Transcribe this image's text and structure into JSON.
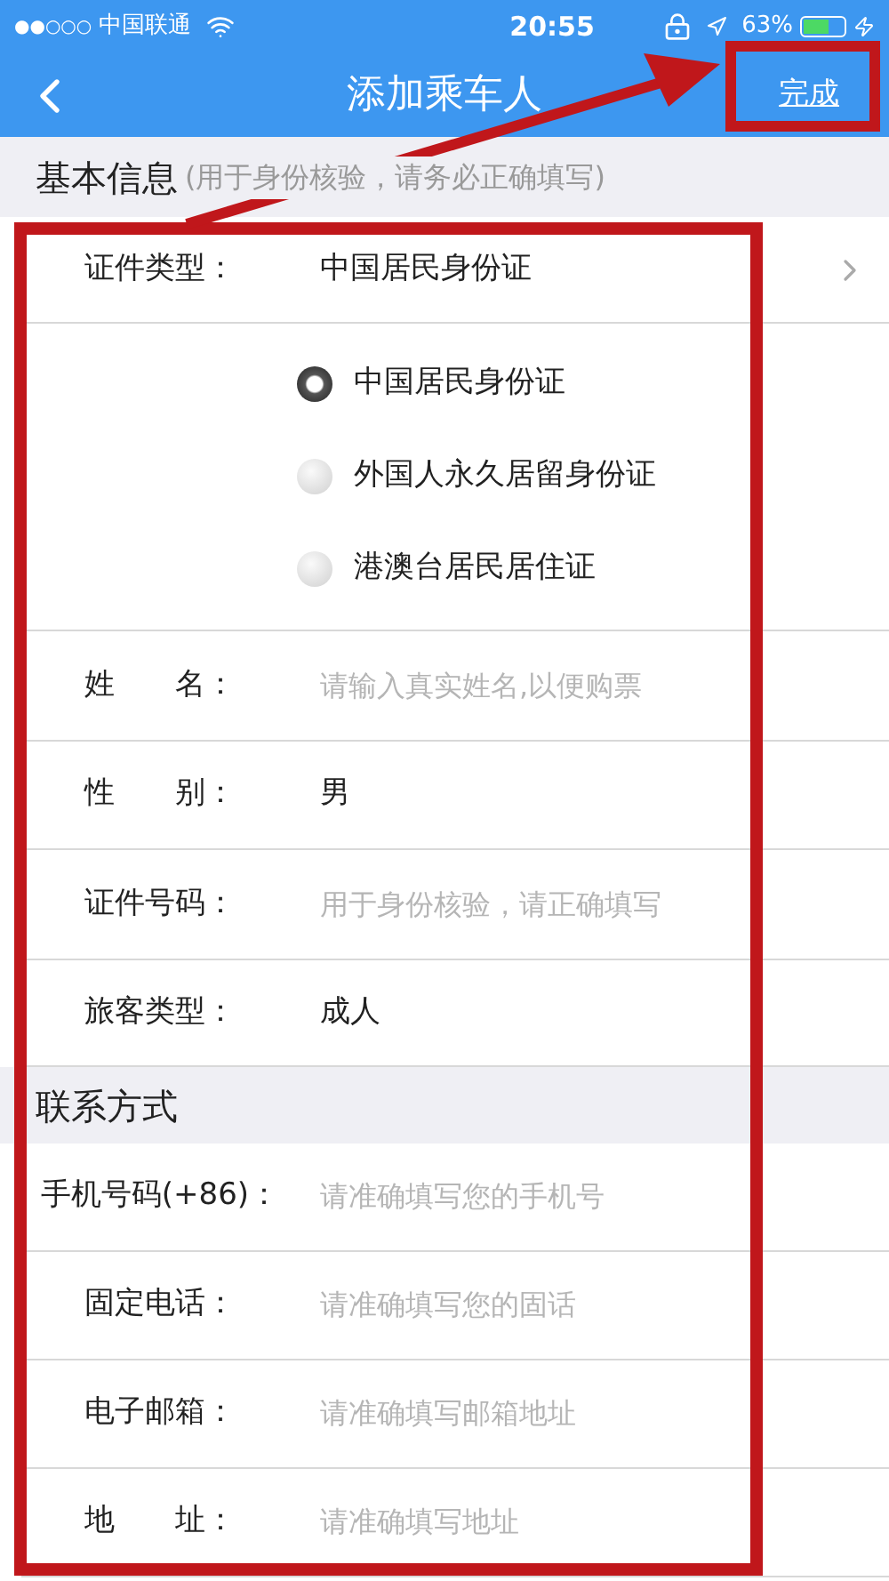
{
  "status_bar": {
    "signal": "●●○○○",
    "carrier": "中国联通",
    "time": "20:55",
    "battery": "63%"
  },
  "nav": {
    "title": "添加乘车人",
    "action": "完成"
  },
  "sections": [
    {
      "title": "基本信息",
      "note": "(用于身份核验，请务必正确填写)",
      "rows": [
        {
          "kind": "select",
          "label": "证件类型：",
          "value": "中国居民身份证"
        },
        {
          "kind": "options",
          "options": [
            {
              "label": "中国居民身份证",
              "selected": true
            },
            {
              "label": "外国人永久居留身份证",
              "selected": false
            },
            {
              "label": "港澳台居民居住证",
              "selected": false
            }
          ]
        },
        {
          "kind": "input",
          "label": "姓　　名：",
          "placeholder": "请输入真实姓名,以便购票"
        },
        {
          "kind": "text",
          "label": "性　　别：",
          "value": "男"
        },
        {
          "kind": "input",
          "label": "证件号码：",
          "placeholder": "用于身份核验，请正确填写"
        },
        {
          "kind": "text",
          "label": "旅客类型：",
          "value": "成人"
        }
      ]
    },
    {
      "title": "联系方式",
      "rows": [
        {
          "kind": "input",
          "label": "手机号码(+86)：",
          "placeholder": "请准确填写您的手机号"
        },
        {
          "kind": "input",
          "label": "固定电话：",
          "placeholder": "请准确填写您的固话"
        },
        {
          "kind": "input",
          "label": "电子邮箱：",
          "placeholder": "请准确填写邮箱地址"
        },
        {
          "kind": "input",
          "label": "地　　址：",
          "placeholder": "请准确填写地址"
        }
      ]
    }
  ]
}
